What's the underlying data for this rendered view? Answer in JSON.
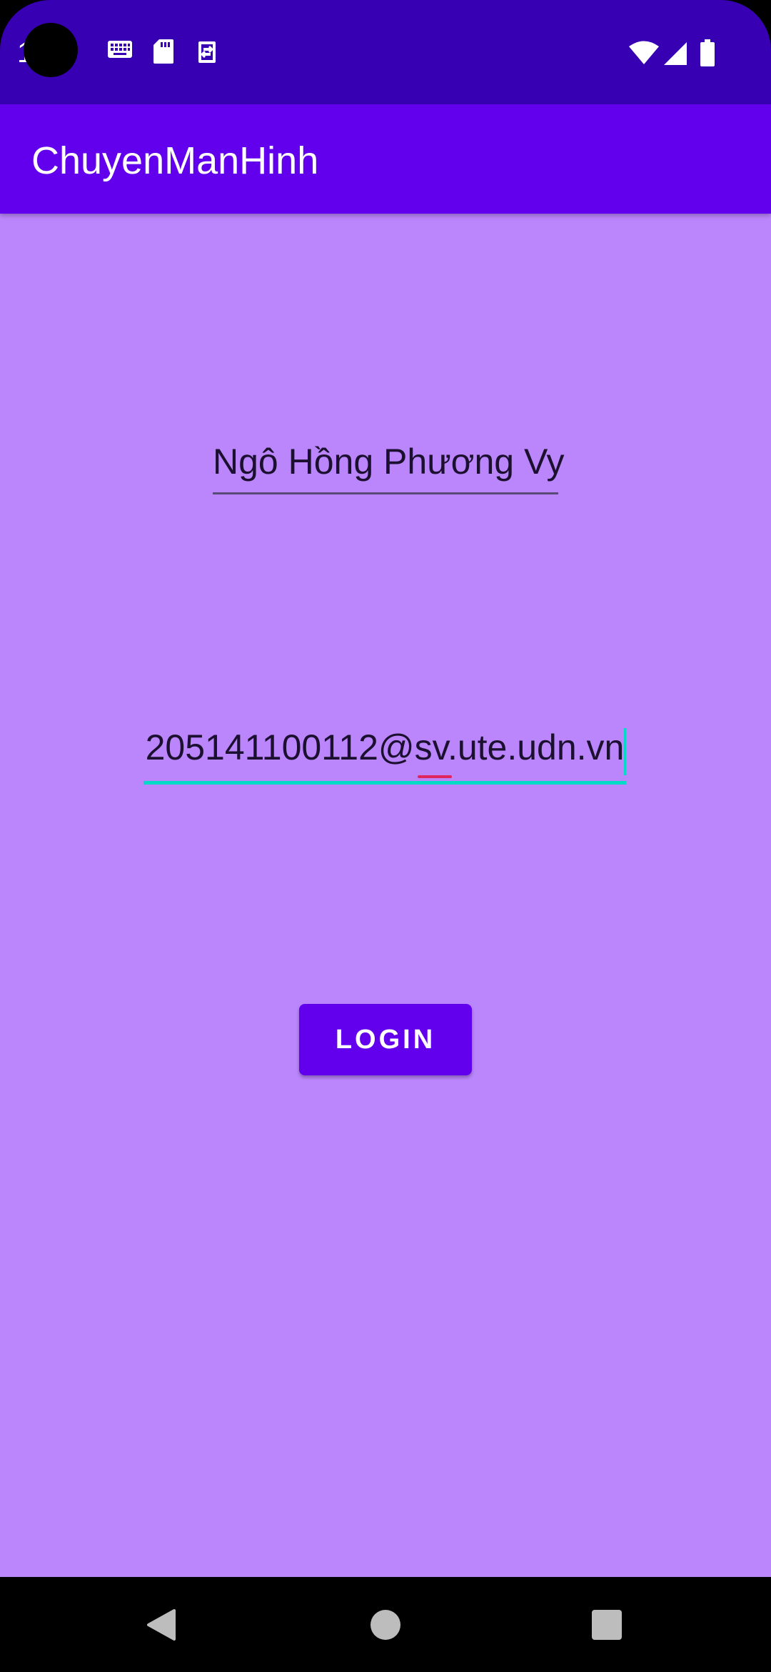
{
  "status_bar": {
    "time": "1  7",
    "icons": [
      "keyboard-icon",
      "sd-card-icon",
      "sync-icon",
      "wifi-icon",
      "signal-icon",
      "battery-icon"
    ],
    "background": "#3700b3"
  },
  "app_bar": {
    "title": "ChuyenManHinh",
    "background": "#6200ee"
  },
  "content": {
    "background": "#bb86fc",
    "name_field": {
      "value": "Ngô Hồng Phương Vy"
    },
    "email_field": {
      "value": "205141100112@sv.ute.udn.vn",
      "focused": true,
      "accent": "#03dac5"
    },
    "login_button": {
      "label": "LOGIN"
    }
  },
  "nav_bar": {
    "buttons": [
      "back-icon",
      "home-icon",
      "recents-icon"
    ]
  }
}
